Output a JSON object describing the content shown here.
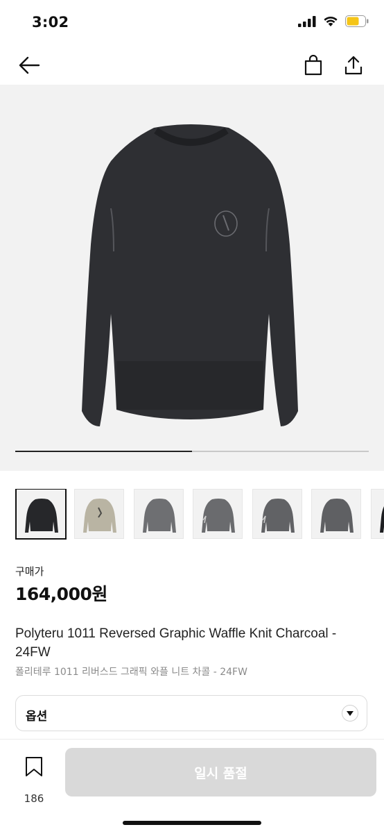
{
  "status_bar": {
    "time": "3:02"
  },
  "nav": {
    "back_icon": "arrow-left-icon",
    "bag_icon": "shopping-bag-icon",
    "share_icon": "share-icon"
  },
  "gallery": {
    "progress": 0.5,
    "selected_index": 0,
    "thumbnail_count": 7
  },
  "product": {
    "price_label": "구매가",
    "price": "164,000원",
    "title_en": "Polyteru 1011 Reversed Graphic Waffle Knit Charcoal - 24FW",
    "title_ko": "폴리테루 1011 리버스드 그래픽 와플 니트 차콜 - 24FW"
  },
  "option": {
    "label": "옵션",
    "icon": "caret-down-icon"
  },
  "bottom": {
    "bookmark_count": "186",
    "soldout_label": "일시 품절",
    "bookmark_icon": "bookmark-icon"
  },
  "colors": {
    "accent": "#111111",
    "button_disabled": "#d9d9d9",
    "battery": "#f5c518"
  }
}
